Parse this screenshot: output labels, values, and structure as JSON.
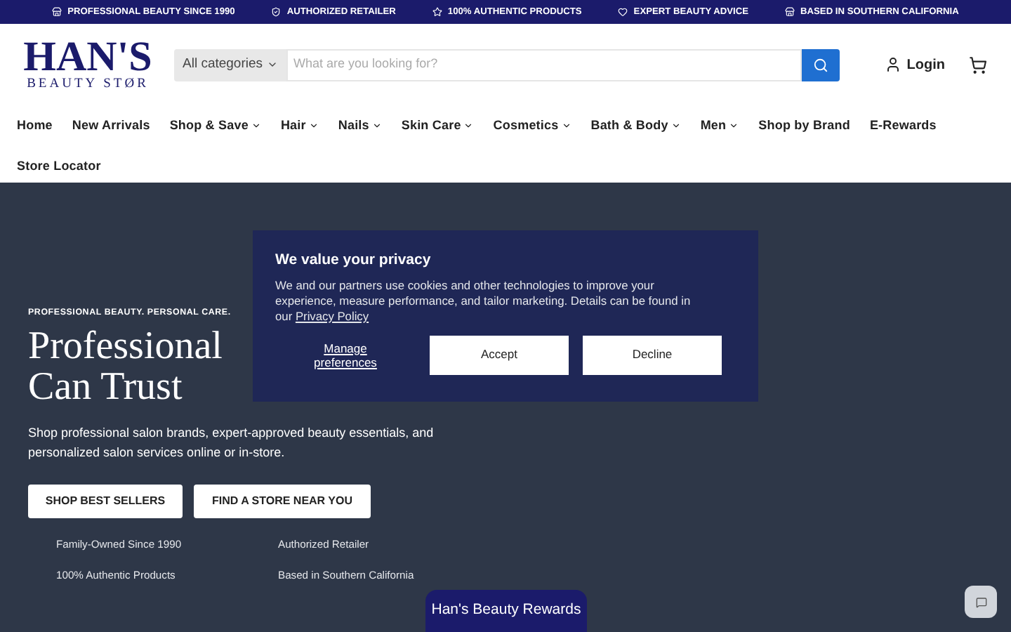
{
  "announcement_bar": [
    {
      "label": "PROFESSIONAL BEAUTY SINCE 1990"
    },
    {
      "label": "AUTHORIZED RETAILER"
    },
    {
      "label": "100% AUTHENTIC PRODUCTS"
    },
    {
      "label": "EXPERT BEAUTY ADVICE"
    },
    {
      "label": "BASED IN SOUTHERN CALIFORNIA"
    }
  ],
  "logo": {
    "title": "HAN'S",
    "subtitle": "BEAUTY STØR"
  },
  "search": {
    "category": "All categories",
    "placeholder": "What are you looking for?"
  },
  "login": "Login",
  "nav": [
    {
      "label": "Home",
      "dropdown": false
    },
    {
      "label": "New Arrivals",
      "dropdown": false
    },
    {
      "label": "Shop & Save",
      "dropdown": true
    },
    {
      "label": "Hair",
      "dropdown": true
    },
    {
      "label": "Nails",
      "dropdown": true
    },
    {
      "label": "Skin Care",
      "dropdown": true
    },
    {
      "label": "Cosmetics",
      "dropdown": true
    },
    {
      "label": "Bath & Body",
      "dropdown": true
    },
    {
      "label": "Men",
      "dropdown": true
    },
    {
      "label": "Shop by Brand",
      "dropdown": false
    },
    {
      "label": "E-Rewards",
      "dropdown": false
    },
    {
      "label": "Store Locator",
      "dropdown": false
    }
  ],
  "hero": {
    "eyebrow": "PROFESSIONAL BEAUTY. PERSONAL CARE.",
    "title_lines": [
      "Professional",
      "Can Trust"
    ],
    "description": "Shop professional salon brands, expert-approved beauty essentials, and personalized salon services online or in-store.",
    "buttons": [
      "SHOP BEST SELLERS",
      "FIND A STORE NEAR YOU"
    ],
    "features": [
      "Family-Owned Since 1990",
      "Authorized Retailer",
      "100% Authentic Products",
      "Based in Southern California"
    ]
  },
  "cookie_banner": {
    "title": "We value your privacy",
    "text": "We and our partners use cookies and other technologies to improve your experience, measure performance, and tailor marketing. Details can be found in our",
    "link": "Privacy Policy",
    "manage": "Manage preferences",
    "accept": "Accept",
    "decline": "Decline"
  },
  "rewards_tab": "Han's Beauty Rewards"
}
